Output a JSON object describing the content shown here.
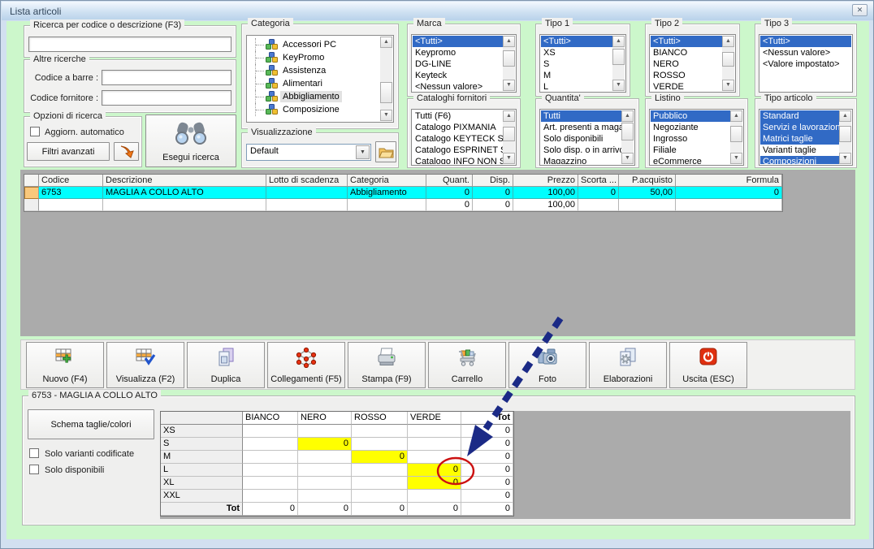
{
  "window": {
    "title": "Lista articoli"
  },
  "filters": {
    "ricerca_title": "Ricerca per codice o descrizione (F3)",
    "ricerca_value": "",
    "altre_title": "Altre ricerche",
    "codice_barre_label": "Codice a barre :",
    "codice_barre_value": "",
    "codice_fornitore_label": "Codice fornitore :",
    "codice_fornitore_value": "",
    "opzioni_title": "Opzioni di ricerca",
    "aggiorn_label": "Aggiorn. automatico",
    "filtri_button": "Filtri avanzati",
    "esegui_button": "Esegui ricerca",
    "visualizzazione_title": "Visualizzazione",
    "visualizzazione_value": "Default"
  },
  "listboxes": {
    "categoria": {
      "title": "Categoria",
      "items": [
        "Accessori PC",
        "KeyPromo",
        "Assistenza",
        "Alimentari",
        "Abbigliamento",
        "Composizione"
      ],
      "selected_index": 4
    },
    "marca": {
      "title": "Marca",
      "items": [
        "<Tutti>",
        "Keypromo",
        "DG-LINE",
        "Keyteck",
        "<Nessun valore>"
      ],
      "selected": [
        0
      ]
    },
    "cataloghi": {
      "title": "Cataloghi fornitori",
      "items": [
        "Tutti (F6)",
        "Catalogo PIXMANIA",
        "Catalogo KEYTECK SR",
        "Catalogo ESPRINET S",
        "Catalogo INFO NON S"
      ],
      "selected": []
    },
    "tipo1": {
      "title": "Tipo 1",
      "items": [
        "<Tutti>",
        "XS",
        "S",
        "M",
        "L"
      ],
      "selected": [
        0
      ]
    },
    "quantita": {
      "title": "Quantita'",
      "items": [
        "Tutti",
        "Art. presenti a magaz",
        "Solo disponibili",
        "Solo disp. o in arrivo",
        "Magazzino"
      ],
      "selected": [
        0
      ]
    },
    "tipo2": {
      "title": "Tipo 2",
      "items": [
        "<Tutti>",
        "BIANCO",
        "NERO",
        "ROSSO",
        "VERDE"
      ],
      "selected": [
        0
      ]
    },
    "listino": {
      "title": "Listino",
      "items": [
        "Pubblico",
        "Negoziante",
        "Ingrosso",
        "Filiale",
        "eCommerce"
      ],
      "selected": [
        0
      ]
    },
    "tipo3": {
      "title": "Tipo 3",
      "items": [
        "<Tutti>",
        "<Nessun valore>",
        "<Valore impostato>"
      ],
      "selected": [
        0
      ]
    },
    "tipo_articolo": {
      "title": "Tipo articolo",
      "items": [
        "Standard",
        "Servizi e lavorazioni",
        "Matrici taglie",
        "Varianti taglie",
        "Composizioni"
      ],
      "selected": [
        0,
        1,
        2,
        4
      ]
    }
  },
  "results_table": {
    "columns": [
      "Codice",
      "Descrizione",
      "Lotto di scadenza",
      "Categoria",
      "Quant.",
      "Disp.",
      "Prezzo",
      "Scorta ...",
      "P.acquisto",
      "Formula"
    ],
    "rows": [
      {
        "cells": [
          "6753",
          "MAGLIA A COLLO ALTO",
          "",
          "Abbigliamento",
          "0",
          "0",
          "100,00",
          "0",
          "50,00",
          "0"
        ],
        "selected": true
      },
      {
        "cells": [
          "",
          "",
          "",
          "",
          "0",
          "0",
          "100,00",
          "",
          "",
          ""
        ],
        "selected": false
      }
    ]
  },
  "toolbar": {
    "buttons": [
      {
        "label": "Nuovo (F4)",
        "icon": "table-add-icon"
      },
      {
        "label": "Visualizza (F2)",
        "icon": "table-check-icon"
      },
      {
        "label": "Duplica",
        "icon": "copy-pages-icon"
      },
      {
        "label": "Collegamenti (F5)",
        "icon": "network-nodes-icon"
      },
      {
        "label": "Stampa (F9)",
        "icon": "printer-icon"
      },
      {
        "label": "Carrello",
        "icon": "shopping-cart-icon"
      },
      {
        "label": "Foto",
        "icon": "camera-icon"
      },
      {
        "label": "Elaborazioni",
        "icon": "page-gear-icon"
      },
      {
        "label": "Uscita (ESC)",
        "icon": "power-icon"
      }
    ]
  },
  "detail": {
    "title": "6753 - MAGLIA A COLLO ALTO",
    "schema_button": "Schema taglie/colori",
    "check1": "Solo varianti codificate",
    "check2": "Solo disponibili",
    "matrix": {
      "col_headers": [
        "BIANCO",
        "NERO",
        "ROSSO",
        "VERDE",
        "Tot"
      ],
      "row_headers": [
        "XS",
        "S",
        "M",
        "L",
        "XL",
        "XXL",
        "Tot"
      ],
      "cells": [
        [
          "",
          "",
          "",
          "",
          "0"
        ],
        [
          "",
          "0",
          "",
          "",
          "0"
        ],
        [
          "",
          "",
          "0",
          "",
          "0"
        ],
        [
          "",
          "",
          "",
          "0",
          "0"
        ],
        [
          "",
          "",
          "",
          "0",
          "0"
        ],
        [
          "",
          "",
          "",
          "",
          "0"
        ],
        [
          "0",
          "0",
          "0",
          "0",
          "0"
        ]
      ],
      "highlighted": [
        [
          1,
          1
        ],
        [
          2,
          2
        ],
        [
          3,
          3
        ],
        [
          4,
          3
        ]
      ],
      "circled": [
        3,
        3
      ]
    }
  },
  "colors": {
    "selection_blue": "#316ac5",
    "row_highlight_cyan": "#00ffff",
    "cell_highlight_yellow": "#ffff00",
    "window_green": "#ccf7cb",
    "panel_gray": "#ababab",
    "selector_orange": "#f9c87c",
    "arrow_navy": "#1b2a86",
    "circle_red": "#cc1111"
  }
}
